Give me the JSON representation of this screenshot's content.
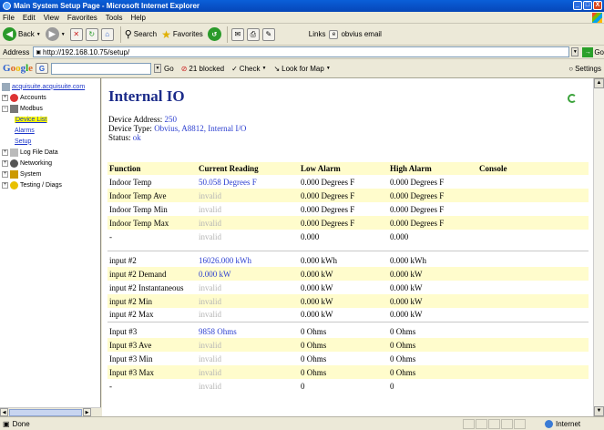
{
  "window": {
    "title": "Main System Setup Page - Microsoft Internet Explorer",
    "minimize": "_",
    "maximize": "□",
    "close": "X"
  },
  "menu": [
    "File",
    "Edit",
    "View",
    "Favorites",
    "Tools",
    "Help"
  ],
  "toolbar": {
    "back": "Back",
    "search": "Search",
    "favorites": "Favorites",
    "links": "Links",
    "obvius_email": "obvius email"
  },
  "address": {
    "label": "Address",
    "url": "http://192.168.10.75/setup/",
    "go": "Go"
  },
  "google": {
    "logo": "Google",
    "g": "G",
    "go": "Go",
    "blocked": "21 blocked",
    "check": "Check",
    "lookformap": "Look for Map",
    "settings": "Settings"
  },
  "sidebar": {
    "root": "acquisuite.acquisuite.com",
    "items": [
      {
        "label": "Accounts"
      },
      {
        "label": "Modbus"
      },
      {
        "label": "Device List"
      },
      {
        "label": "Alarms"
      },
      {
        "label": "Setup"
      },
      {
        "label": "Log File Data"
      },
      {
        "label": "Networking"
      },
      {
        "label": "System"
      },
      {
        "label": "Testing / Diags"
      }
    ]
  },
  "page": {
    "title": "Internal IO",
    "device_address_label": "Device Address:",
    "device_address": "250",
    "device_type_label": "Device Type:",
    "device_type": "Obvius, A8812, Internal I/O",
    "status_label": "Status:",
    "status": "ok"
  },
  "table": {
    "headers": [
      "Function",
      "Current Reading",
      "Low Alarm",
      "High Alarm",
      "Console"
    ],
    "groups": [
      [
        [
          "Indoor Temp",
          "50.058 Degrees F",
          "0.000 Degrees F",
          "0.000 Degrees F"
        ],
        [
          "Indoor Temp Ave",
          "invalid",
          "0.000 Degrees F",
          "0.000 Degrees F"
        ],
        [
          "Indoor Temp Min",
          "invalid",
          "0.000 Degrees F",
          "0.000 Degrees F"
        ],
        [
          "Indoor Temp Max",
          "invalid",
          "0.000 Degrees F",
          "0.000 Degrees F"
        ],
        [
          "-",
          "invalid",
          "0.000",
          "0.000"
        ]
      ],
      [
        [
          "input #2",
          "16026.000 kWh",
          "0.000 kWh",
          "0.000 kWh"
        ],
        [
          "input #2 Demand",
          "0.000 kW",
          "0.000 kW",
          "0.000 kW"
        ],
        [
          "input #2 Instantaneous",
          "invalid",
          "0.000 kW",
          "0.000 kW"
        ],
        [
          "input #2 Min",
          "invalid",
          "0.000 kW",
          "0.000 kW"
        ],
        [
          "input #2 Max",
          "invalid",
          "0.000 kW",
          "0.000 kW"
        ]
      ],
      [
        [
          "Input #3",
          "9858 Ohms",
          "0 Ohms",
          "0 Ohms"
        ],
        [
          "Input #3 Ave",
          "invalid",
          "0 Ohms",
          "0 Ohms"
        ],
        [
          "Input #3 Min",
          "invalid",
          "0 Ohms",
          "0 Ohms"
        ],
        [
          "Input #3 Max",
          "invalid",
          "0 Ohms",
          "0 Ohms"
        ],
        [
          "-",
          "invalid",
          "0",
          "0"
        ]
      ]
    ]
  },
  "status": {
    "text": "Done",
    "zone": "Internet"
  }
}
